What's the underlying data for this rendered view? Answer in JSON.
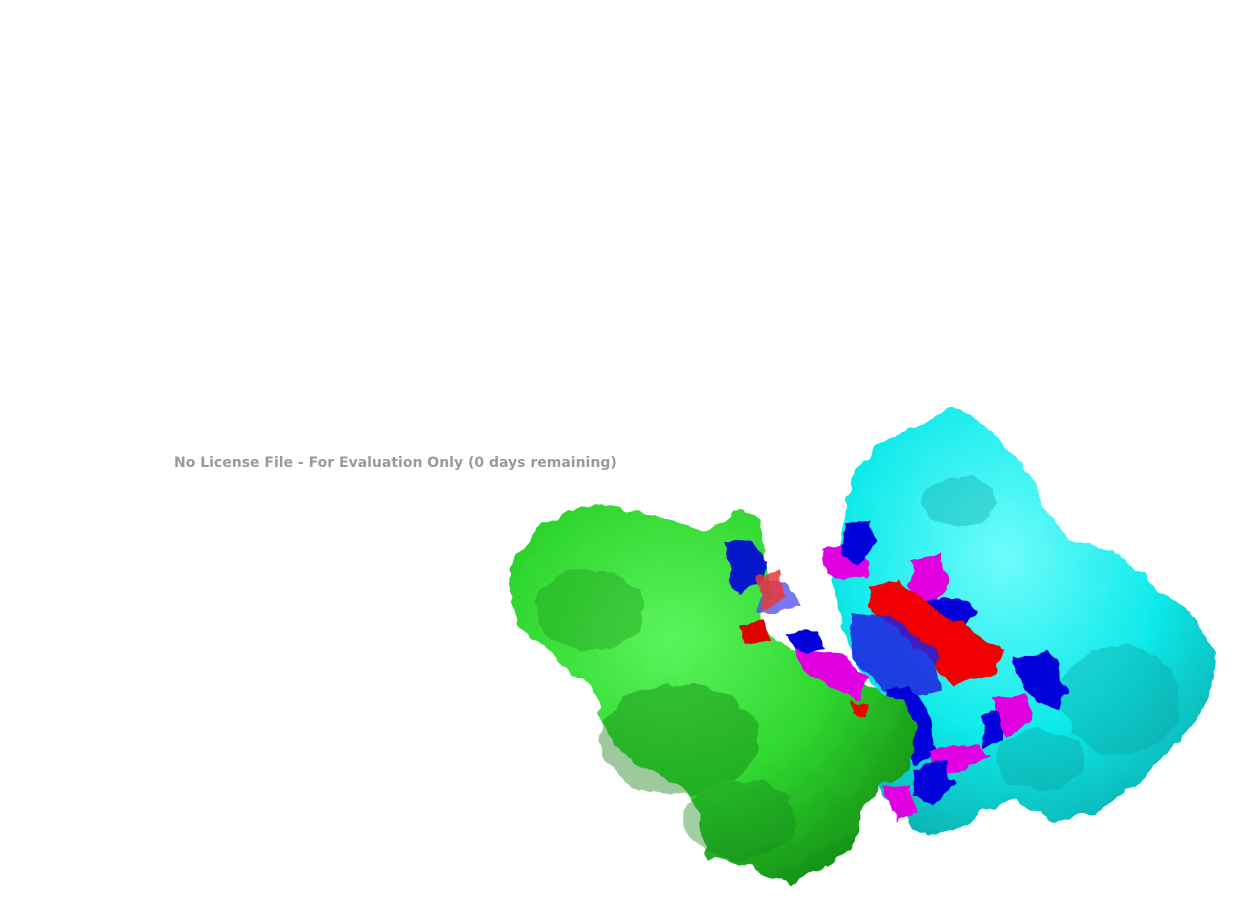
{
  "watermark": {
    "text": "No License File - For Evaluation Only (0 days remaining)",
    "color": "#9a9a9a"
  },
  "render": {
    "background": "#ffffff",
    "chains": [
      {
        "name": "chain-green",
        "color": "#2fe02f"
      },
      {
        "name": "chain-cyan",
        "color": "#00f0f0"
      }
    ],
    "highlight_colors": {
      "blue": "#0000e6",
      "magenta": "#f000f0",
      "red": "#f00000"
    }
  }
}
